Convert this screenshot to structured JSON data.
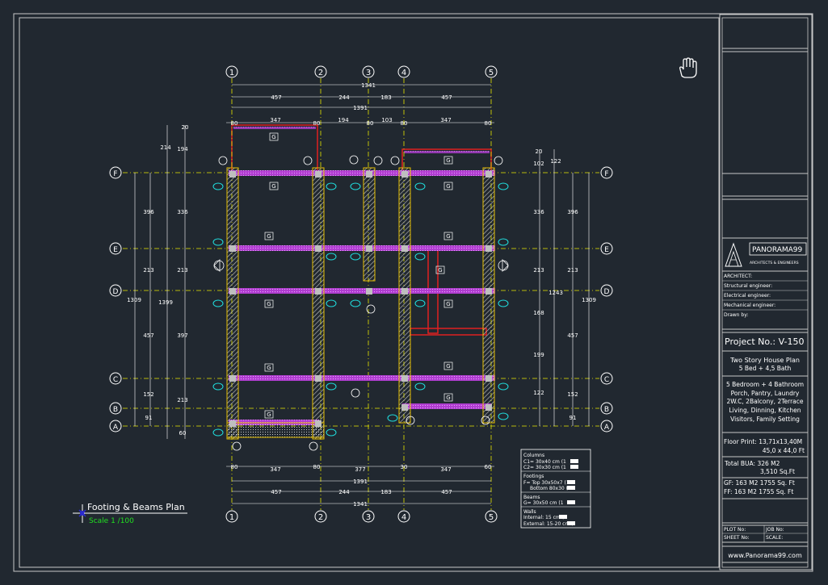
{
  "drawing": {
    "title": "Footing & Beams Plan",
    "scale": "Scale  1 /100",
    "grid_x_labels": [
      "1",
      "2",
      "3",
      "4",
      "5"
    ],
    "grid_y_labels": [
      "F",
      "E",
      "D",
      "C",
      "B",
      "A"
    ],
    "top_dims_1": [
      "457",
      "244",
      "183",
      "457"
    ],
    "top_total": "1341",
    "top_total_2": "1391",
    "top_dims_2": [
      "80",
      "347",
      "80",
      "194",
      "80",
      "103",
      "80",
      "347",
      "80"
    ],
    "bottom_dims_1": [
      "80",
      "347",
      "80",
      "377",
      "30",
      "347",
      "60"
    ],
    "bottom_total_2": "1391",
    "bottom_dims_2": [
      "457",
      "244",
      "183",
      "457"
    ],
    "bottom_total": "1341",
    "left_dims_outer": [
      "396",
      "213",
      "457",
      "152",
      "91"
    ],
    "left_total_outer": "1309",
    "left_dims_inner": [
      "336",
      "213",
      "397",
      "213",
      "60"
    ],
    "left_total_inner": "1399",
    "left_top_dims": [
      "214",
      "194",
      "20"
    ],
    "right_dims_outer": [
      "396",
      "213",
      "457",
      "152",
      "91"
    ],
    "right_total_outer": "1309",
    "right_dims_inner": [
      "336",
      "213",
      "168",
      "199",
      "122"
    ],
    "right_total_inner": "1243",
    "right_top_dims": [
      "102",
      "122",
      "20"
    ],
    "footing_tag": "G",
    "hand_cursor": "hand-cursor-icon",
    "legend": {
      "columns_header": "Columns",
      "columns": [
        "C1= 30x40 cm (1",
        "C2= 30x30 cm (1"
      ],
      "footings_header": "Footings",
      "footings": [
        "F= Top 30x50x7 (1",
        "Bottom 80x30 (2"
      ],
      "beams_header": "Beams",
      "beams": [
        "G= 30x50 cm (1"
      ],
      "walls_header": "Walls",
      "walls": [
        "Internal: 15 cm (",
        "External: 15-20 cm ("
      ]
    }
  },
  "title_block": {
    "company": "PANORAMA99",
    "company_sub": "ARCHITECTS & ENGINEERS",
    "roles": [
      "ARCHITECT:",
      "Structural engineer:",
      "Electrical engineer:",
      "Mechanical engineer:",
      "Drawn by:"
    ],
    "project_no": "Project No.: V-150",
    "plan_title": "Two Story House Plan",
    "plan_sub": "5 Bed + 4,5 Bath",
    "description": [
      "5 Bedroom + 4 Bathroom",
      "Porch, Pantry, Laundry",
      "2W.C, 2Balcony, 2Terrace",
      "Living, Dinning, Kitchen",
      "Visitors, Family Setting"
    ],
    "floor_print": "Floor Print: 13,71x13,40M",
    "floor_print_ft": "45,0 x 44,0 Ft",
    "total_bua": "Total BUA: 326   M2",
    "total_bua_ft": "3,510 Sq.Ft",
    "gf": "GF:      163 M2    1755 Sq. Ft",
    "ff": "FF:      163 M2    1755 Sq. Ft",
    "plot_no": "PLOT No:",
    "job_no": "JOB No:",
    "sheet_no": "SHEET No:",
    "scale_label": "SCALE:",
    "website": "www.Panorama99.com"
  }
}
